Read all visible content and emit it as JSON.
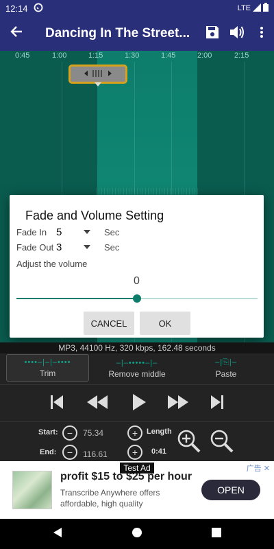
{
  "status_bar": {
    "time": "12:14",
    "network": "LTE"
  },
  "app_bar": {
    "title": "Dancing In The Street..."
  },
  "timeline": {
    "ticks": [
      "0:45",
      "1:00",
      "1:15",
      "1:30",
      "1:45",
      "2:00",
      "2:15"
    ]
  },
  "dialog": {
    "title": "Fade and Volume Setting",
    "fade_in": {
      "label": "Fade In",
      "value": "5",
      "unit": "Sec"
    },
    "fade_out": {
      "label": "Fade Out",
      "value": "3",
      "unit": "Sec"
    },
    "adjust_label": "Adjust the volume",
    "volume_value": "0",
    "volume_slider_fraction": 0.5,
    "cancel_label": "CANCEL",
    "ok_label": "OK"
  },
  "file_info": "MP3, 44100 Hz, 320 kbps, 162.48 seconds",
  "modes": {
    "trim": "Trim",
    "remove_middle": "Remove middle",
    "paste": "Paste",
    "active": "trim"
  },
  "times": {
    "start_label": "Start:",
    "start_value": "75.34",
    "end_label": "End:",
    "end_value": "116.61",
    "length_label": "Length",
    "length_value": "0:41"
  },
  "ad": {
    "test_label": "Test Ad",
    "headline": "profit $15 to $25 per hour",
    "description": "Transcribe Anywhere offers affordable, high quality",
    "cta": "OPEN",
    "ad_badge": "广告"
  },
  "colors": {
    "app_bar": "#2a2f7a",
    "waveform": "#0d6b5c",
    "accent": "#0e7d6b",
    "handle_border": "#d9a21b"
  }
}
